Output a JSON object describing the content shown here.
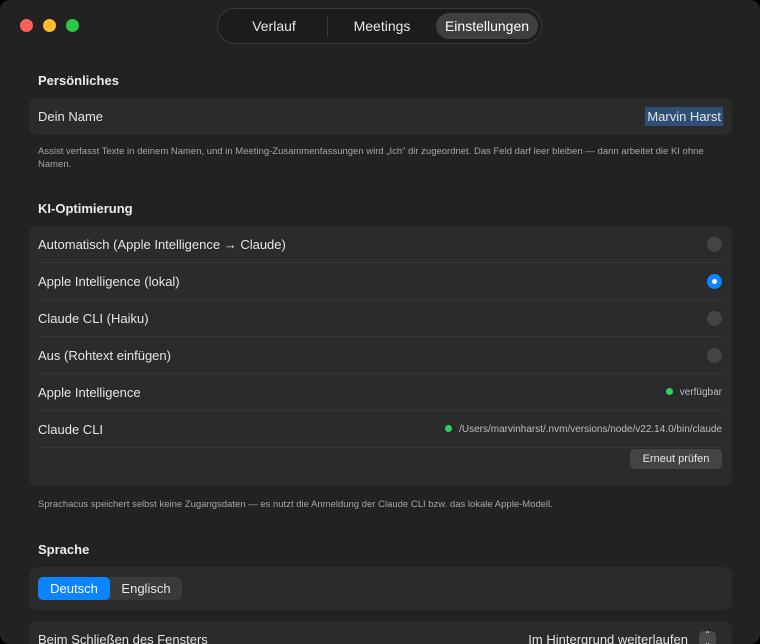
{
  "tabs": [
    {
      "label": "Verlauf"
    },
    {
      "label": "Meetings"
    },
    {
      "label": "Einstellungen"
    }
  ],
  "personal": {
    "title": "Persönliches",
    "name_label": "Dein Name",
    "name_value": "Marvin Harst",
    "help": "Assist verfasst Texte in deinem Namen, und in Meeting-Zusammenfassungen wird „Ich“ dir zugeordnet. Das Feld darf leer bleiben — dann arbeitet die KI ohne Namen."
  },
  "ai": {
    "title": "KI-Optimierung",
    "options": [
      {
        "label": "Automatisch (Apple Intelligence → Claude)",
        "selected": false
      },
      {
        "label": "Apple Intelligence (lokal)",
        "selected": true
      },
      {
        "label": "Claude CLI (Haiku)",
        "selected": false
      },
      {
        "label": "Aus (Rohtext einfügen)",
        "selected": false
      }
    ],
    "status": [
      {
        "label": "Apple Intelligence",
        "value": "verfügbar",
        "color": "#30d158"
      },
      {
        "label": "Claude CLI",
        "value": "/Users/marvinharst/.nvm/versions/node/v22.14.0/bin/claude",
        "color": "#30d158"
      }
    ],
    "recheck_label": "Erneut prüfen",
    "help": "Sprachacus speichert selbst keine Zugangsdaten — es nutzt die Anmeldung der Claude CLI bzw. das lokale Apple-Modell."
  },
  "language": {
    "title": "Sprache",
    "options": [
      "Deutsch",
      "Englisch"
    ],
    "selected": "Deutsch"
  },
  "close_behavior": {
    "label": "Beim Schließen des Fensters",
    "value": "Im Hintergrund weiterlaufen"
  },
  "colors": {
    "accent": "#0a84ff",
    "background": "#222222",
    "card": "#2b2b2b",
    "status_ok": "#30d158"
  }
}
